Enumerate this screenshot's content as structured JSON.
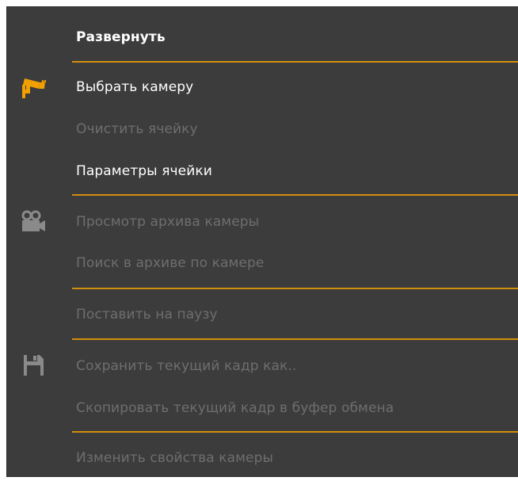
{
  "menu": {
    "items": [
      {
        "label": "Развернуть"
      },
      {
        "label": "Выбрать камеру"
      },
      {
        "label": "Очистить ячейку"
      },
      {
        "label": "Параметры ячейки"
      },
      {
        "label": "Просмотр архива камеры"
      },
      {
        "label": "Поиск в архиве по камере"
      },
      {
        "label": "Поставить на паузу"
      },
      {
        "label": "Сохранить текущий кадр как.."
      },
      {
        "label": "Скопировать текущий кадр в буфер обмена"
      },
      {
        "label": "Изменить свойства камеры"
      }
    ]
  },
  "colors": {
    "background": "#3c3c3c",
    "separator": "#d28e0e",
    "enabled_text": "#ffffff",
    "disabled_text": "#6e6e6e",
    "camera_icon": "#f0a000",
    "disabled_icon": "#8a8a8a"
  },
  "icons": {
    "select_camera": "security-camera-icon",
    "archive": "video-camera-icon",
    "save_frame": "floppy-disk-icon"
  }
}
